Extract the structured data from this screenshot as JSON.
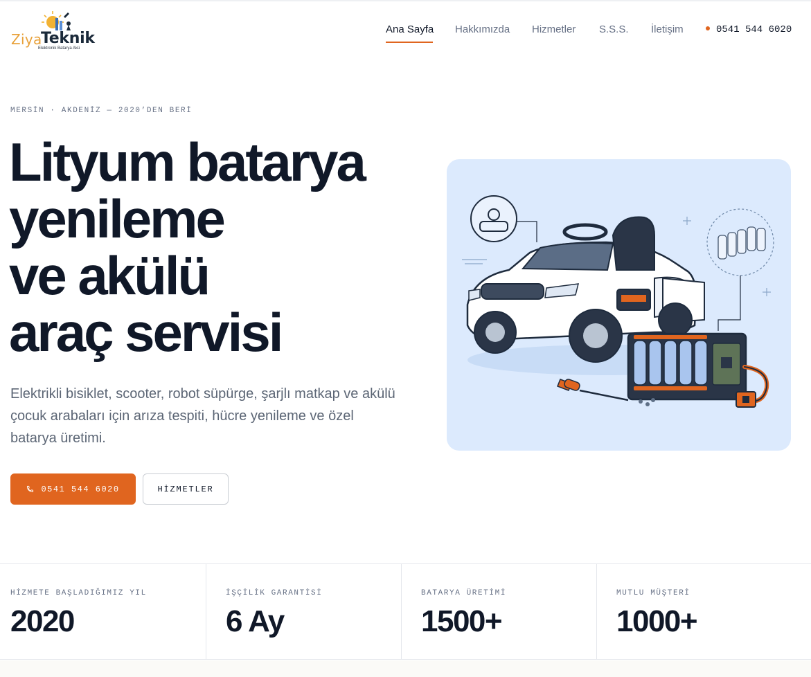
{
  "brand": {
    "name_part1": "Ziya",
    "name_part2": "Teknik",
    "tagline": "Elektronik Batarya Akü",
    "accent_color": "#e0651f"
  },
  "nav": {
    "items": [
      {
        "label": "Ana Sayfa",
        "active": true
      },
      {
        "label": "Hakkımızda",
        "active": false
      },
      {
        "label": "Hizmetler",
        "active": false
      },
      {
        "label": "S.S.S.",
        "active": false
      },
      {
        "label": "İletişim",
        "active": false
      }
    ],
    "phone": "0541 544 6020"
  },
  "hero": {
    "eyebrow": "MERSİN · AKDENİZ — 2020’DEN BERİ",
    "title_lines": [
      "Lityum batarya",
      "yenileme",
      "ve akülü",
      "araç servisi"
    ],
    "description": "Elektrikli bisiklet, scooter, robot süpürge, şarjlı matkap ve akülü çocuk arabaları için arıza tespiti, hücre yenileme ve özel batarya üretimi.",
    "primary_button": "0541 544 6020",
    "secondary_button": "HİZMETLER",
    "image_subject": "illustration-ride-on-toy-car-battery-pack"
  },
  "stats": [
    {
      "label": "HİZMETE BAŞLADIĞIMIZ YIL",
      "value": "2020"
    },
    {
      "label": "İŞÇİLİK GARANTİSİ",
      "value": "6 Ay"
    },
    {
      "label": "BATARYA ÜRETİMİ",
      "value": "1500+"
    },
    {
      "label": "MUTLU MÜŞTERİ",
      "value": "1000+"
    }
  ]
}
